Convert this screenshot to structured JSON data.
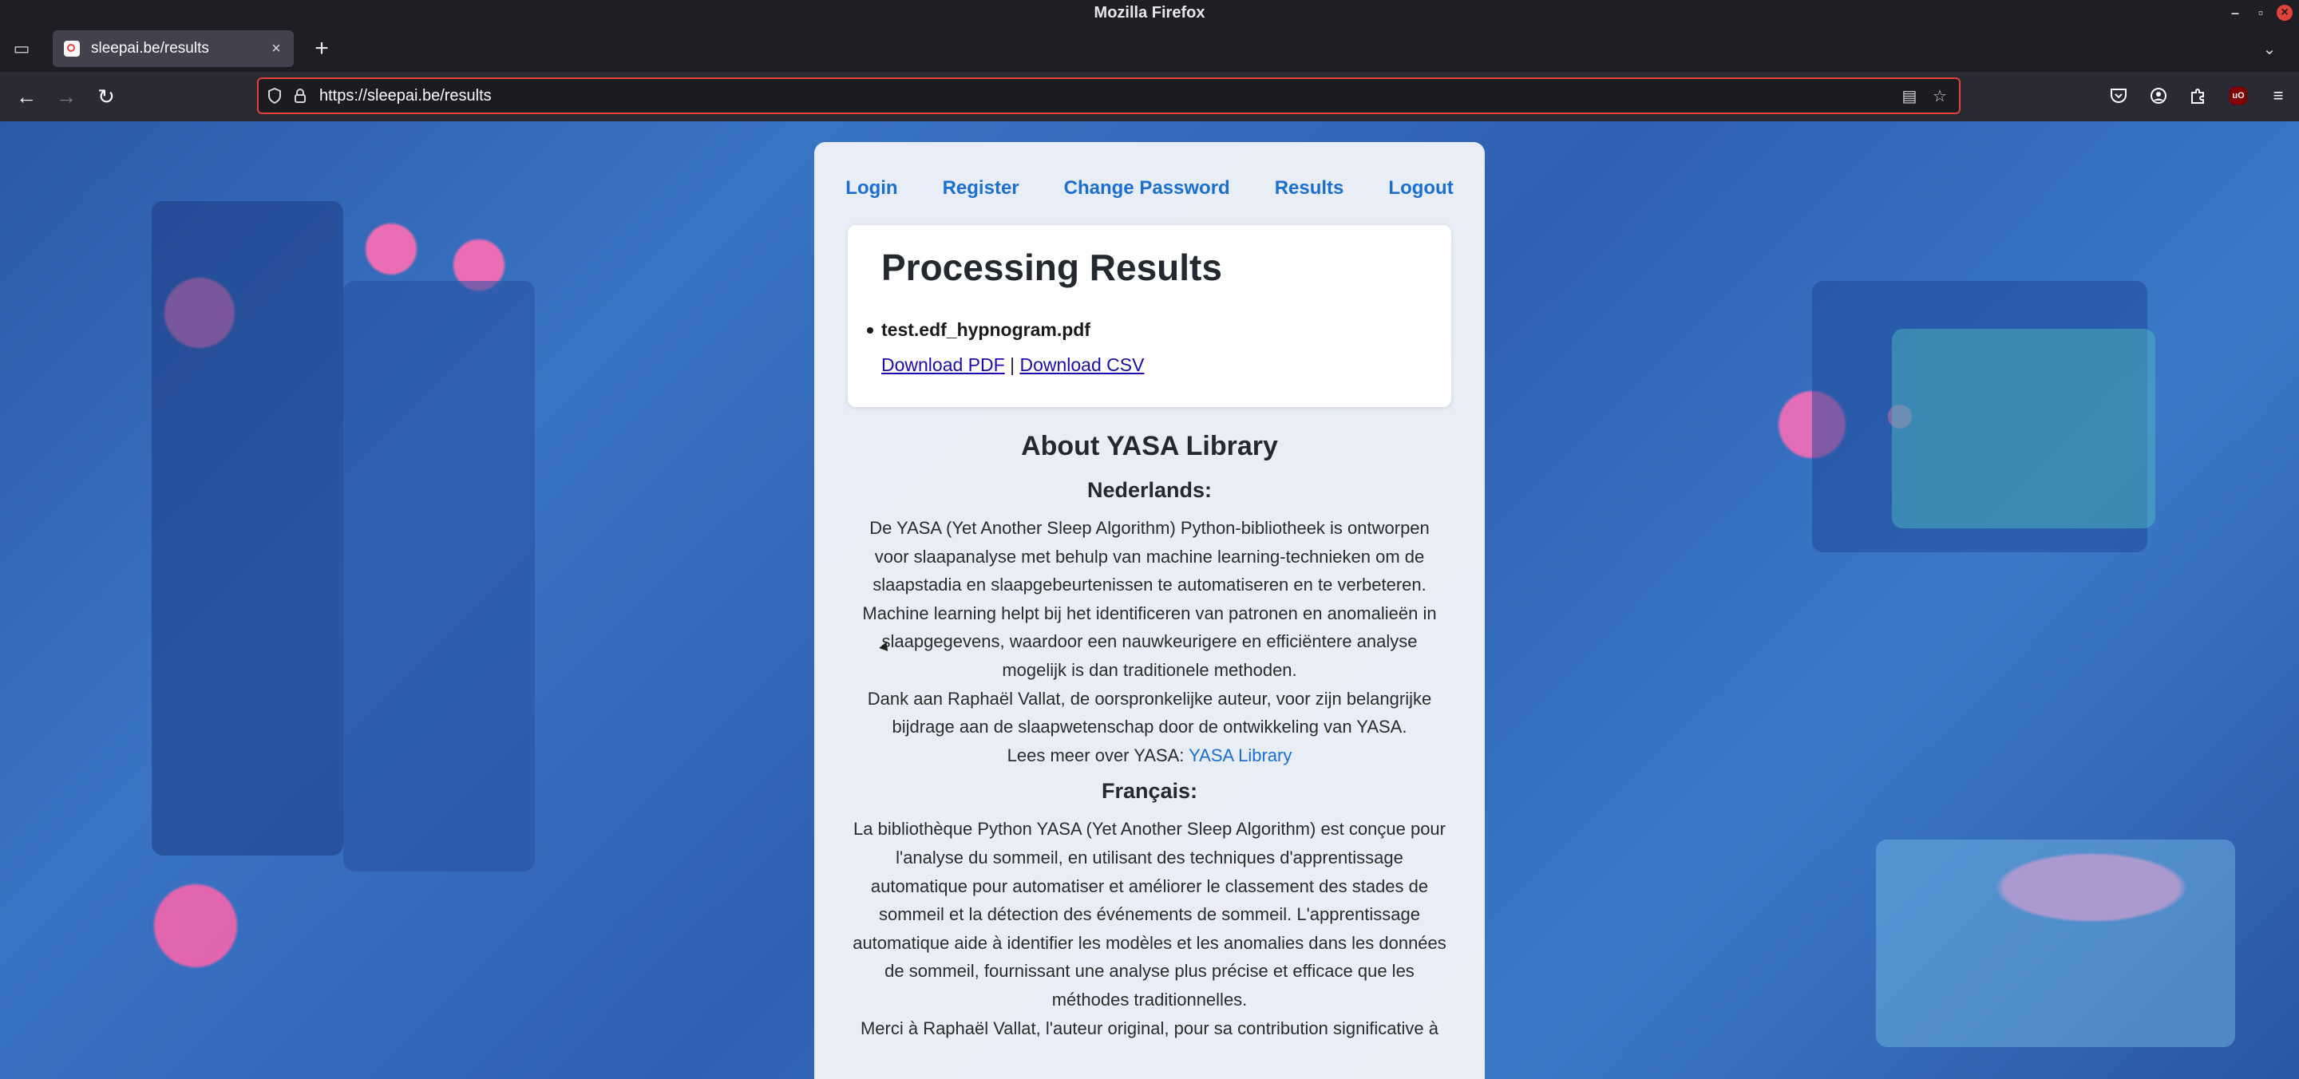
{
  "window": {
    "title": "Mozilla Firefox"
  },
  "tabs": [
    {
      "title": "sleepai.be/results"
    }
  ],
  "urlbar": {
    "url": "https://sleepai.be/results"
  },
  "nav": {
    "items": [
      {
        "label": "Login"
      },
      {
        "label": "Register"
      },
      {
        "label": "Change Password"
      },
      {
        "label": "Results"
      },
      {
        "label": "Logout"
      }
    ]
  },
  "results": {
    "heading": "Processing Results",
    "file_name": "test.edf_hypnogram.pdf",
    "download_pdf": "Download PDF",
    "separator": "|",
    "download_csv": "Download CSV"
  },
  "about": {
    "heading": "About YASA Library",
    "nl": {
      "heading": "Nederlands:",
      "p1": "De YASA (Yet Another Sleep Algorithm) Python-bibliotheek is ontworpen voor slaapanalyse met behulp van machine learning-technieken om de slaapstadia en slaapgebeurtenissen te automatiseren en te verbeteren. Machine learning helpt bij het identificeren van patronen en anomalieën in slaapgegevens, waardoor een nauwkeurigere en efficiëntere analyse mogelijk is dan traditionele methoden.",
      "p2": "Dank aan Raphaël Vallat, de oorspronkelijke auteur, voor zijn belangrijke bijdrage aan de slaapwetenschap door de ontwikkeling van YASA.",
      "read_more": "Lees meer over YASA:",
      "link": "YASA Library"
    },
    "fr": {
      "heading": "Français:",
      "p1": "La bibliothèque Python YASA (Yet Another Sleep Algorithm) est conçue pour l'analyse du sommeil, en utilisant des techniques d'apprentissage automatique pour automatiser et améliorer le classement des stades de sommeil et la détection des événements de sommeil. L'apprentissage automatique aide à identifier les modèles et les anomalies dans les données de sommeil, fournissant une analyse plus précise et efficace que les méthodes traditionnelles.",
      "p2": "Merci à Raphaël Vallat, l'auteur original, pour sa contribution significative à"
    }
  },
  "icons": {
    "back": "arrow-left-icon",
    "forward": "arrow-right-icon",
    "reload": "reload-icon",
    "shield": "shield-icon",
    "lock": "lock-icon",
    "reader": "reader-view-icon",
    "bookmark": "star-icon",
    "pocket": "pocket-icon",
    "account": "account-icon",
    "extensions": "puzzle-icon",
    "ublock": "ublock-origin-icon",
    "menu": "hamburger-menu-icon"
  },
  "colors": {
    "link": "#1b6fd1",
    "urlbar_border": "#e0433a",
    "chrome_bg": "#2b2a33"
  }
}
